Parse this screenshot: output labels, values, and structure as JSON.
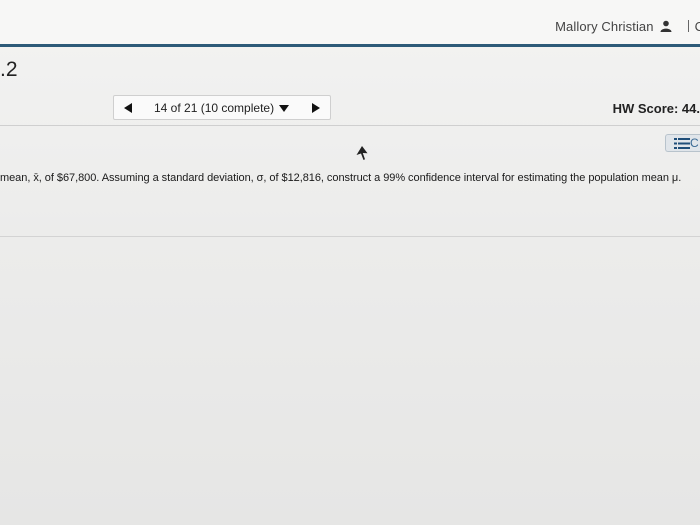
{
  "header": {
    "user_name": "Mallory Christian",
    "cut_off_text": "C"
  },
  "section": {
    "number": ".2"
  },
  "navigation": {
    "position_label": "14 of 21 (10 complete)"
  },
  "score": {
    "label": "HW Score: 44."
  },
  "toolbar": {
    "cut_label": "C"
  },
  "question": {
    "text": "mean, x̄, of $67,800. Assuming a standard deviation, σ, of $12,816, construct a 99% confidence interval for estimating the population mean μ."
  },
  "colors": {
    "header_rule": "#2d5a78",
    "background": "#eeeeed"
  },
  "icons": {
    "user": "user-icon",
    "list": "list-icon",
    "prev": "left-triangle",
    "next": "right-triangle",
    "caret": "caret-down"
  }
}
